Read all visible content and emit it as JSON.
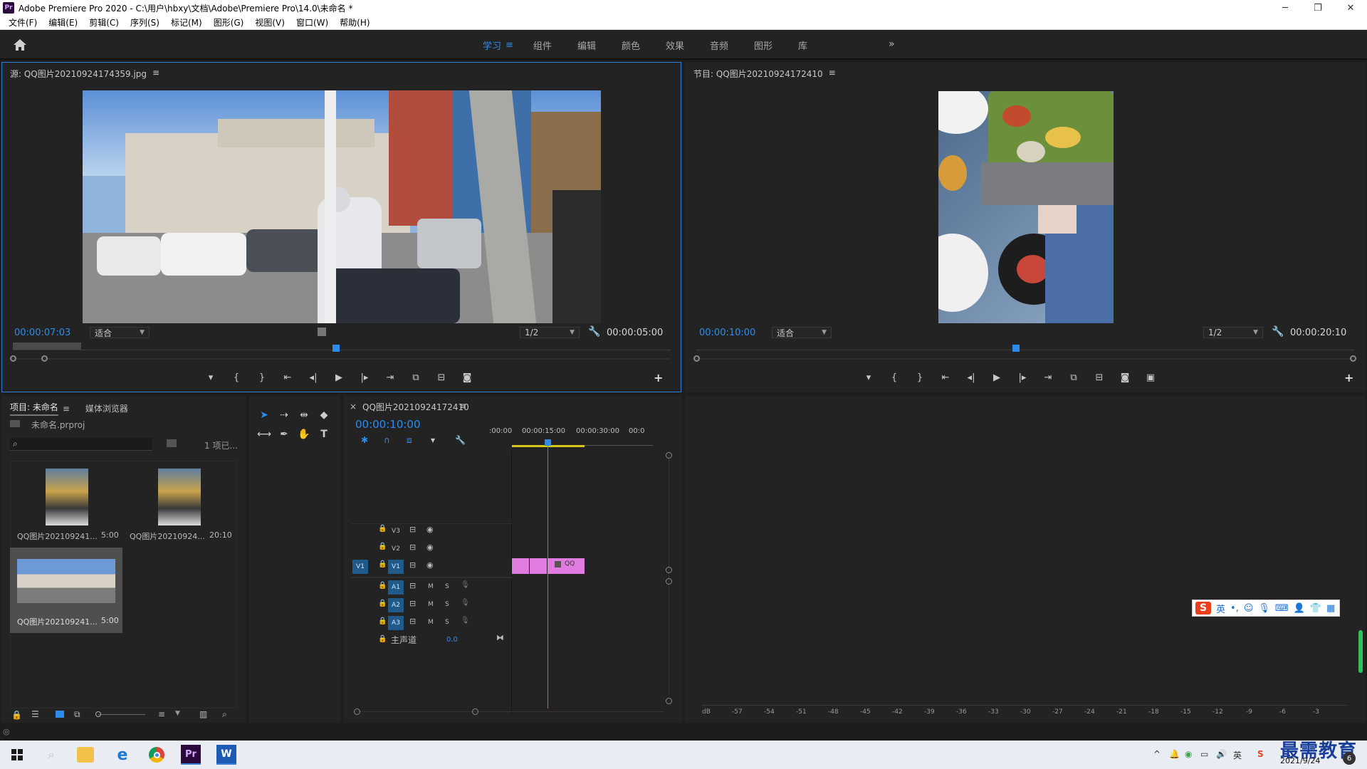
{
  "window": {
    "app_badge": "Pr",
    "title": "Adobe Premiere Pro 2020 - C:\\用户\\hbxy\\文档\\Adobe\\Premiere Pro\\14.0\\未命名 *",
    "minimize": "─",
    "restore": "❐",
    "close": "✕"
  },
  "menu": [
    "文件(F)",
    "编辑(E)",
    "剪辑(C)",
    "序列(S)",
    "标记(M)",
    "图形(G)",
    "视图(V)",
    "窗口(W)",
    "帮助(H)"
  ],
  "workspaces": {
    "tabs": [
      "学习",
      "组件",
      "编辑",
      "颜色",
      "效果",
      "音频",
      "图形",
      "库"
    ],
    "active": "学习",
    "menu_icon": "≡",
    "more": "»"
  },
  "source_monitor": {
    "title": "源: QQ图片20210924174359.jpg",
    "menu_icon": "≡",
    "timecode": "00:00:07:03",
    "fit": "适合",
    "resolution": "1/2",
    "duration": "00:00:05:00"
  },
  "program_monitor": {
    "title": "节目: QQ图片20210924172410",
    "menu_icon": "≡",
    "timecode": "00:00:10:00",
    "fit": "适合",
    "resolution": "1/2",
    "duration": "00:00:20:10"
  },
  "project": {
    "tab_project": "项目: 未命名",
    "tab_menu": "≡",
    "tab_media": "媒体浏览器",
    "filename": "未命名.prproj",
    "items_count": "1 项已...",
    "items": [
      {
        "name": "QQ图片202109241...",
        "duration": "5:00"
      },
      {
        "name": "QQ图片20210924...",
        "duration": "20:10"
      },
      {
        "name": "QQ图片202109241...",
        "duration": "5:00"
      }
    ]
  },
  "timeline": {
    "close": "×",
    "sequence": "QQ图片20210924172410",
    "menu_icon": "≡",
    "timecode": "00:00:10:00",
    "ruler": [
      ":00:00",
      "00:00:15:00",
      "00:00:30:00",
      "00:0"
    ],
    "video_tracks": [
      {
        "source": "",
        "name": "V3"
      },
      {
        "source": "",
        "name": "V2"
      },
      {
        "source": "V1",
        "name": "V1"
      }
    ],
    "audio_tracks": [
      {
        "name": "A1",
        "m": "M",
        "s": "S"
      },
      {
        "name": "A2",
        "m": "M",
        "s": "S"
      },
      {
        "name": "A3",
        "m": "M",
        "s": "S"
      }
    ],
    "master": {
      "label": "主声道",
      "value": "0.0"
    },
    "clip_label": "QQ"
  },
  "meter": {
    "unit": "dB",
    "scale": [
      "-57",
      "-54",
      "-51",
      "-48",
      "-45",
      "-42",
      "-39",
      "-36",
      "-33",
      "-30",
      "-27",
      "-24",
      "-21",
      "-18",
      "-15",
      "-12",
      "-9",
      "-6",
      "-3"
    ]
  },
  "ime": {
    "logo": "S",
    "lang": "英",
    "punct": "•,",
    "emoji": "☺",
    "mic": "🎙",
    "keyboard": "⌨",
    "user": "👤",
    "shirt": "👕",
    "grid": "▦"
  },
  "taskbar": {
    "date": "2021/9/24",
    "word_label": "W",
    "pr_label": "Pr",
    "ime_tray": "英",
    "notif_count": "6",
    "watermark": "最需教育"
  },
  "colors": {
    "accent": "#2d8ceb",
    "clip": "#e07be0",
    "panel": "#232323"
  }
}
